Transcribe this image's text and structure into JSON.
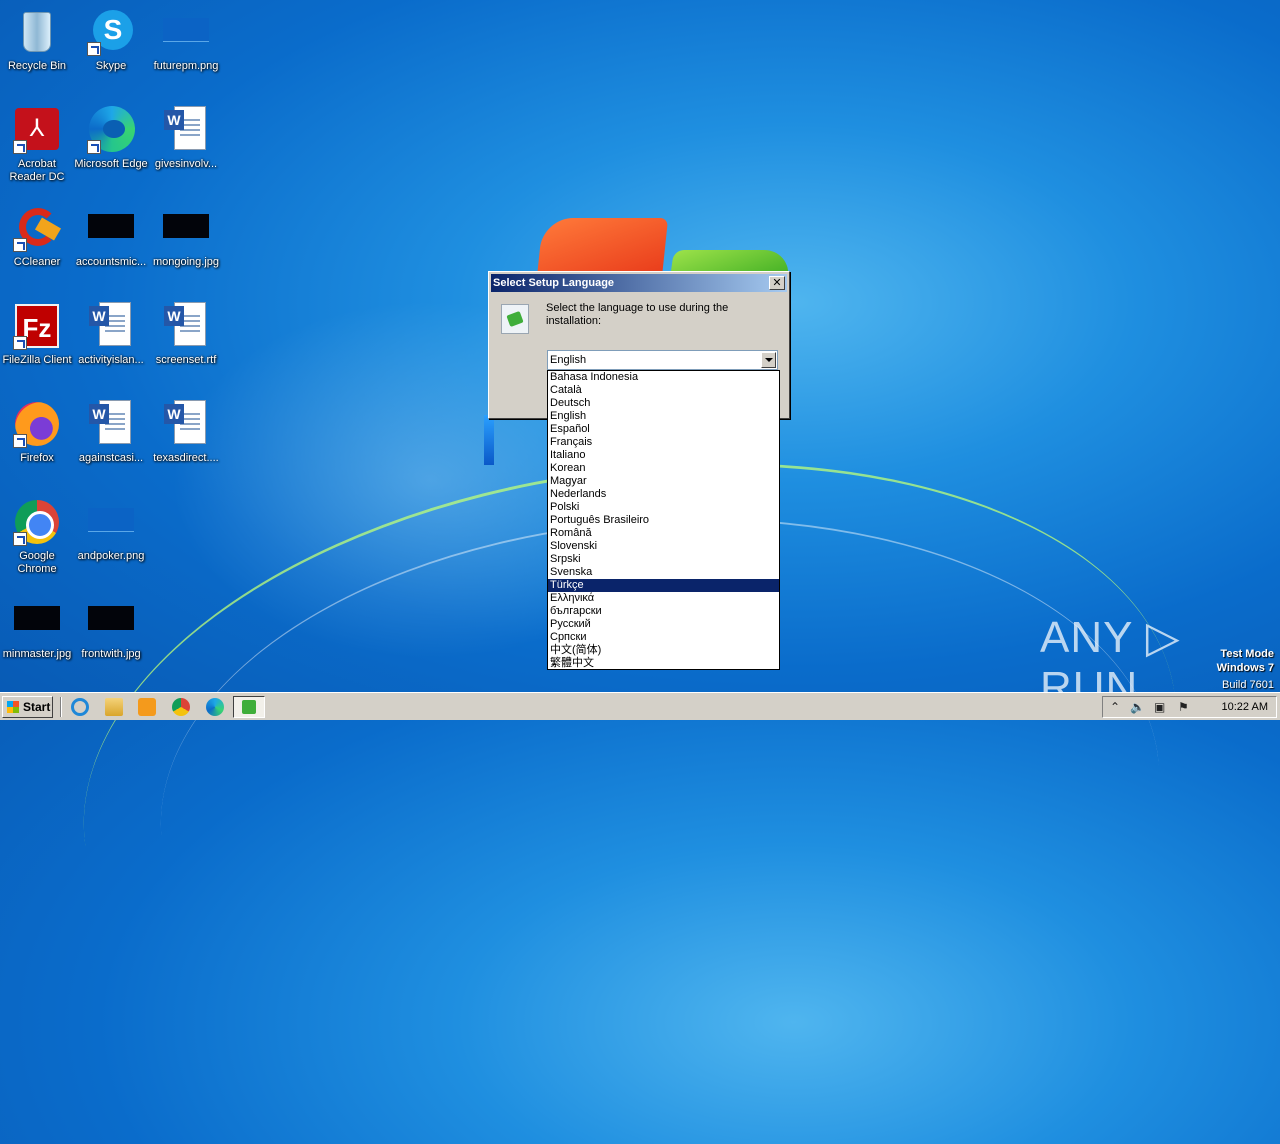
{
  "desktop": {
    "icons": [
      {
        "label": "Recycle Bin",
        "icon": "recycle-bin-icon"
      },
      {
        "label": "Skype",
        "icon": "skype-icon"
      },
      {
        "label": "futurepm.png",
        "icon": "png-thumbnail-icon"
      },
      {
        "label": "Acrobat Reader DC",
        "icon": "acrobat-icon"
      },
      {
        "label": "Microsoft Edge",
        "icon": "edge-icon"
      },
      {
        "label": "givesinvolv...",
        "icon": "word-doc-icon"
      },
      {
        "label": "CCleaner",
        "icon": "ccleaner-icon"
      },
      {
        "label": "accountsmic...",
        "icon": "image-thumbnail-icon"
      },
      {
        "label": "mongoing.jpg",
        "icon": "image-thumbnail-icon"
      },
      {
        "label": "FileZilla Client",
        "icon": "filezilla-icon"
      },
      {
        "label": "activityislan...",
        "icon": "word-doc-icon"
      },
      {
        "label": "screenset.rtf",
        "icon": "word-doc-icon"
      },
      {
        "label": "Firefox",
        "icon": "firefox-icon"
      },
      {
        "label": "againstcasi...",
        "icon": "word-doc-icon"
      },
      {
        "label": "texasdirect....",
        "icon": "word-doc-icon"
      },
      {
        "label": "Google Chrome",
        "icon": "chrome-icon"
      },
      {
        "label": "andpoker.png",
        "icon": "png-thumbnail-icon"
      },
      {
        "label": "minmaster.jpg",
        "icon": "image-thumbnail-icon"
      },
      {
        "label": "frontwith.jpg",
        "icon": "image-thumbnail-icon"
      }
    ]
  },
  "dialog": {
    "title": "Select Setup Language",
    "close_glyph": "✕",
    "prompt": "Select the language to use during the installation:",
    "selected_value": "English",
    "options": [
      "Bahasa Indonesia",
      "Català",
      "Deutsch",
      "English",
      "Español",
      "Français",
      "Italiano",
      "Korean",
      "Magyar",
      "Nederlands",
      "Polski",
      "Português Brasileiro",
      "Română",
      "Slovenski",
      "Srpski",
      "Svenska",
      "Türkçe",
      "Ελληνικά",
      "български",
      "Русский",
      "Српски",
      "中文(简体)",
      "繁體中文"
    ],
    "highlighted_option": "Türkçe"
  },
  "taskbar": {
    "start_label": "Start",
    "pinned": [
      "internet-explorer-icon",
      "explorer-folder-icon",
      "media-player-icon",
      "chrome-icon",
      "edge-icon"
    ],
    "active_task": "setup-task-icon",
    "tray_icons": [
      "show-hidden-icons-chevron",
      "speaker-icon",
      "network-icon",
      "action-center-flag-icon"
    ],
    "clock": "10:22 AM"
  },
  "watermark": {
    "brand": "ANY ▷ RUN",
    "line1": "Test Mode",
    "line2": "Windows 7",
    "line3": "Build 7601"
  },
  "colors": {
    "desktop_blue": "#0a6ccb",
    "title_gradient_start": "#0a246a",
    "selection": "#0a246a",
    "dialog_face": "#d4d0c8"
  }
}
